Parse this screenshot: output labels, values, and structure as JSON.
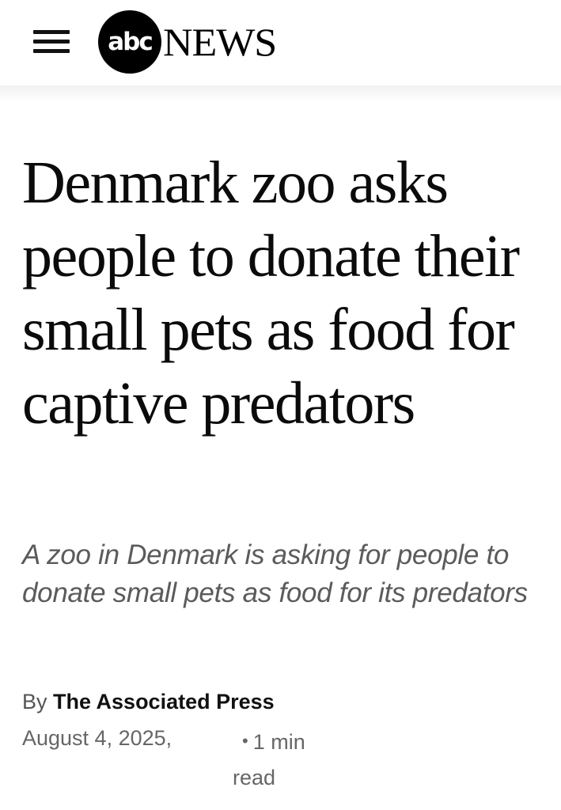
{
  "header": {
    "menu_icon": "hamburger-menu-icon",
    "logo": {
      "circle_text": "abc",
      "word": "NEWS"
    }
  },
  "article": {
    "headline": "Denmark zoo asks people to donate their small pets as food for captive predators",
    "subheadline": "A zoo in Denmark is asking for people to donate small pets as food for its predators",
    "byline_prefix": "By",
    "author": "The Associated Press",
    "date": "August 4, 2025,",
    "read_time_number": "1 min",
    "read_time_suffix": "read"
  }
}
